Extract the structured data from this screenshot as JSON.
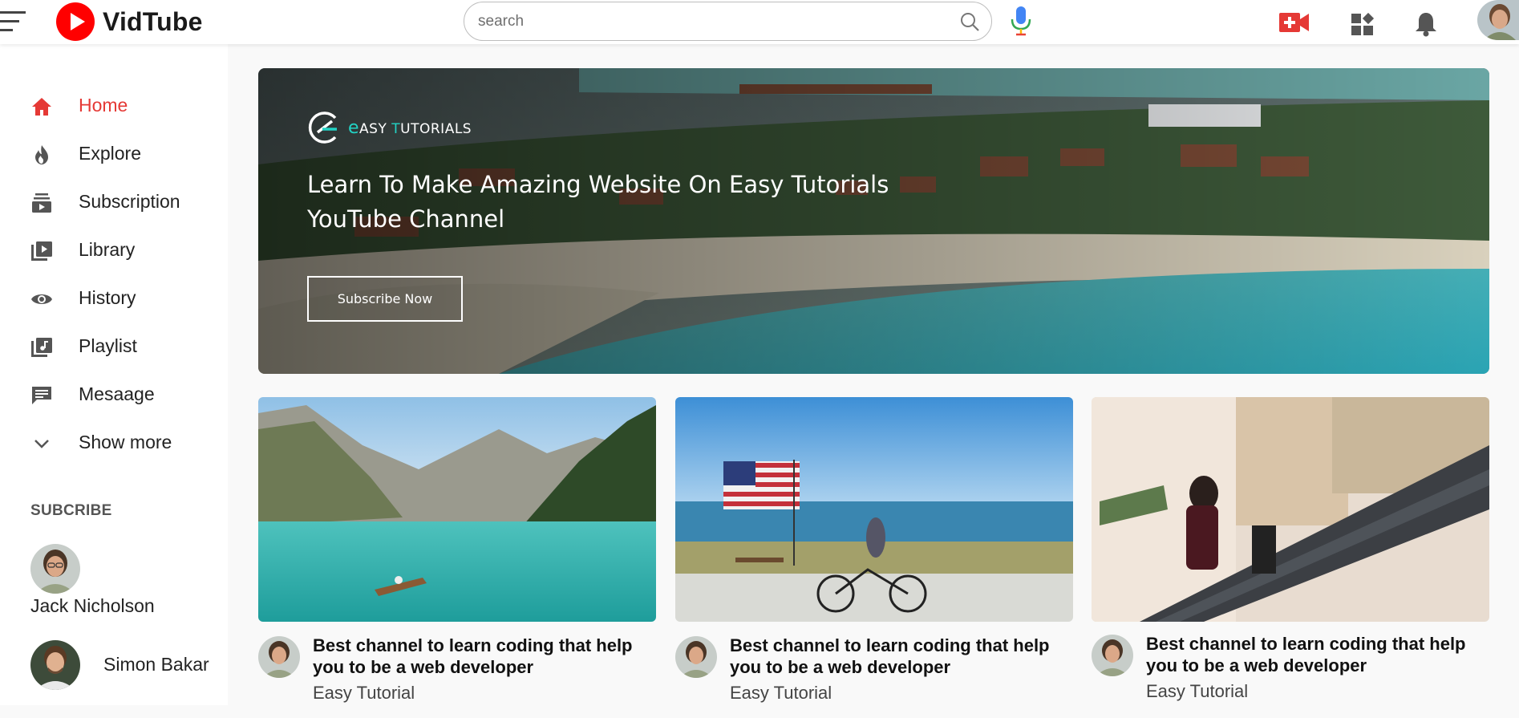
{
  "header": {
    "app_name": "VidTube",
    "search_placeholder": "search",
    "icons": [
      "menu-icon",
      "play-logo-icon",
      "search-icon",
      "mic-icon",
      "video-camera-icon",
      "apps-grid-icon",
      "bell-icon",
      "user-avatar"
    ]
  },
  "sidebar": {
    "items": [
      {
        "label": "Home",
        "icon": "home-icon",
        "active": true
      },
      {
        "label": "Explore",
        "icon": "flame-icon"
      },
      {
        "label": "Subscription",
        "icon": "subscription-icon"
      },
      {
        "label": "Library",
        "icon": "library-icon"
      },
      {
        "label": "History",
        "icon": "eye-icon"
      },
      {
        "label": "Playlist",
        "icon": "playlist-icon"
      },
      {
        "label": "Mesaage",
        "icon": "message-icon"
      },
      {
        "label": "Show more",
        "icon": "chevron-down-icon"
      }
    ],
    "subscribe_title": "SUBCRIBE",
    "subscriptions": [
      {
        "name": "Jack Nicholson"
      },
      {
        "name": "Simon Bakar"
      }
    ]
  },
  "banner": {
    "brand_first": "e",
    "brand_rest_1": "ASY ",
    "brand_t": "T",
    "brand_rest_2": "UTORIALS",
    "title_line1": "Learn To Make Amazing Website On Easy Tutorials",
    "title_line2": "YouTube Channel",
    "button_label": "Subscribe Now"
  },
  "videos": [
    {
      "title": "Best channel to learn coding that help you to be a web developer",
      "channel": "Easy Tutorial",
      "thumbnail": "mountain-lake-boat"
    },
    {
      "title": "Best channel to learn coding that help you to be a web developer",
      "channel": "Easy Tutorial",
      "thumbnail": "beach-flag-bicycle"
    },
    {
      "title": "Best channel to learn coding that help you to be a web developer",
      "channel": "Easy Tutorial",
      "thumbnail": "mall-escalator"
    }
  ],
  "colors": {
    "accent": "#e53935",
    "brand_red": "#ff0000",
    "mic_blue": "#4285f4",
    "brand_teal": "#22d3c5"
  }
}
